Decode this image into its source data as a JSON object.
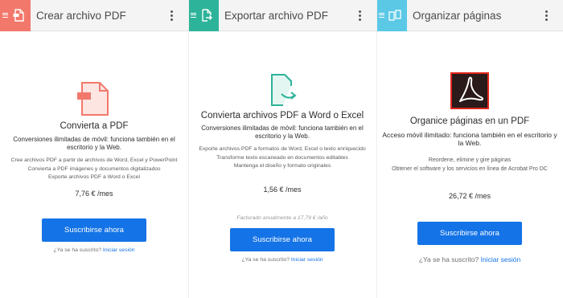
{
  "panels": [
    {
      "title": "Crear archivo PDF",
      "accent": "#f2786b",
      "icon": "create-pdf-icon",
      "heading": "Convierta a PDF",
      "subtitle": "Conversiones ilimitadas de móvil: funciona también en el escritorio y la Web.",
      "features": [
        "Cree archivos PDF a partir de archivos de Word, Excel y PowerPoint",
        "Convierta a PDF imágenes y documentos digitalizados",
        "Exporte archivos PDF a Word o Excel"
      ],
      "price": "7,76 € /mes",
      "billed": "",
      "button": "Suscribirse ahora",
      "signin_prompt": "¿Ya se ha suscrito?",
      "signin_link": "Iniciar sesión"
    },
    {
      "title": "Exportar archivo PDF",
      "accent": "#2db399",
      "icon": "export-pdf-icon",
      "heading": "Convierta archivos PDF a Word o Excel",
      "subtitle": "Conversiones ilimitadas de móvil: funciona también en el escritorio y la Web.",
      "features": [
        "Exporte archivos PDF a formatos de Word, Excel o texto enriquecido",
        "Transforme texto escaneado en documentos editables",
        "Mantenga el diseño y formato originales"
      ],
      "price": "1,56 € /mes",
      "billed": "Facturado anualmente a 17,79 € /año",
      "button": "Suscribirse ahora",
      "signin_prompt": "¿Ya se ha suscrito?",
      "signin_link": "Iniciar sesión"
    },
    {
      "title": "Organizar páginas",
      "accent": "#5bc8e6",
      "icon": "organize-pages-icon",
      "heading": "Organice páginas en un PDF",
      "subtitle": "Acceso móvil ilimitado: funciona también en el escritorio y la Web.",
      "features": [
        "Reordene, elimine y gire páginas",
        "Obtener el software y los servicios en línea de Acrobat Pro DC"
      ],
      "price": "26,72 € /mes",
      "billed": "",
      "button": "Suscribirse ahora",
      "signin_prompt": "¿Ya se ha suscrito?",
      "signin_link": "Iniciar sesión"
    }
  ],
  "colors": {
    "button": "#1473e6",
    "link": "#1473e6",
    "acrobat_logo_bg": "#2b1a1a",
    "acrobat_logo_border": "#e3261c"
  }
}
